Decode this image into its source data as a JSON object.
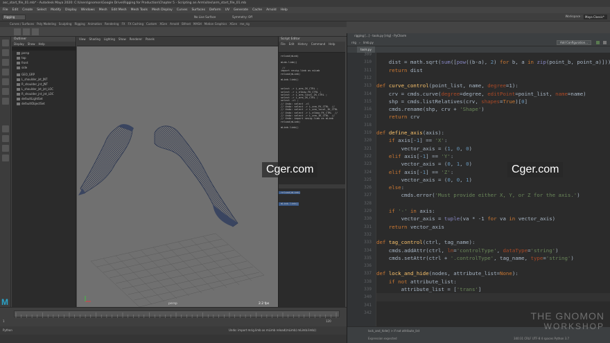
{
  "maya": {
    "window_title": "asc_start_file_01.mb* - Autodesk Maya 2020: C:\\Users\\gnomon\\Google Drive\\Rigging for Production\\Chapter 5 - Scripting an Arm\\sites\\arm_start_file_01.mb",
    "menus": [
      "File",
      "Edit",
      "Create",
      "Select",
      "Modify",
      "Display",
      "Windows",
      "Mesh",
      "Edit Mesh",
      "Mesh Tools",
      "Mesh Display",
      "Curves",
      "Surfaces",
      "Deform",
      "UV",
      "Generate",
      "Cache",
      "Arnold",
      "Help"
    ],
    "menu_set": "Rigging",
    "live_surface": "No Live Surface",
    "symmetry": "Symmetry: Off",
    "workspace": "Maya Classic*",
    "shelf_tabs": [
      "Curves / Surfaces",
      "Poly Modeling",
      "Sculpting",
      "Rigging",
      "Animation",
      "Rendering",
      "FX",
      "FX Caching",
      "Custom",
      "XGen",
      "Arnold",
      "Bifrost",
      "MASH",
      "Motion Graphics",
      "XGen",
      "me_rig"
    ],
    "outliner": {
      "title": "Outliner",
      "menus": [
        "Display",
        "Show",
        "Help"
      ],
      "items": [
        "persp",
        "top",
        "front",
        "side",
        "GEO_GRP",
        "L_shoulder_jnt_JNT",
        "R_shoulder_jnt_JNT",
        "L_shoulder_jnt_jnt_LOC",
        "R_shoulder_jnt_jnt_LOC",
        "defaultLightSet",
        "defaultObjectSet"
      ]
    },
    "viewport": {
      "menus": [
        "View",
        "Shading",
        "Lighting",
        "Show",
        "Renderer",
        "Panels"
      ],
      "camera": "persp",
      "fps": "2.2 fps"
    },
    "script_editor": {
      "title": "Script Editor",
      "menus": [
        "File",
        "Edit",
        "History",
        "Command",
        "Help"
      ],
      "history_lines": [
        "reload(mLmb)",
        "",
        "mLmb.limb()",
        "",
        " //",
        "import neuig.limb as mLimb",
        "reload(mLimb)",
        "",
        "mLimb.limb()",
        "",
        "",
        "select -r L_arm_IK_CTRL ;",
        "select -r L_elbow_FK_CTRL ;",
        "select -r L_arm_local_IK_CTRL ;",
        "select -r L_arm_IK_CTRL ;",
        "select -cl ;",
        "// Undo: select -cl",
        "// Undo: select -r L_arm_FK_CTRL  //",
        "// Undo: select -r L_arm_local_IK_CTRL",
        "// Undo: select -r L_elbow_FK_CTRL  //",
        "// Undo: select -r L_arm_IK_CTRL  //",
        "// Undo: import neuig.limb as mLimb",
        "reload(mLimb)",
        "",
        "mLimb.limb()"
      ],
      "input_lines": [
        "reload(mLimb)",
        "",
        "mLimb.limb()"
      ]
    },
    "timeline_start": "1",
    "timeline_end": "120",
    "command_lang": "Python",
    "command_feedback": "Undo: import mrig.limb as mLimb  reload(mLimb)  mLimb.limb()",
    "help_text": ""
  },
  "pycharm": {
    "title": "rigging [...] - tools.py [rrig] - PyCharm",
    "nav_project": "rrig",
    "nav_file": "limb.py",
    "config_button": "Add Configuration...",
    "tab": "tools.py",
    "lines": [
      {
        "n": "309",
        "code": ""
      },
      {
        "n": "310",
        "code": "    dist = math.sqrt(sum([pow((b-a), 2) for b, a in zip(point_b, point_a)]))"
      },
      {
        "n": "311",
        "code": "    return dist"
      },
      {
        "n": "312",
        "code": ""
      },
      {
        "n": "313",
        "code": "def curve_control(point_list, name, degree=1):"
      },
      {
        "n": "314",
        "code": "    crv = cmds.curve(degree=degree, editPoint=point_list, name=name)"
      },
      {
        "n": "315",
        "code": "    shp = cmds.listRelatives(crv, shapes=True)[0]"
      },
      {
        "n": "316",
        "code": "    cmds.rename(shp, crv + 'Shape')"
      },
      {
        "n": "317",
        "code": "    return crv"
      },
      {
        "n": "318",
        "code": ""
      },
      {
        "n": "319",
        "code": "def define_axis(axis):"
      },
      {
        "n": "320",
        "code": "    if axis[-1] == 'X':"
      },
      {
        "n": "321",
        "code": "        vector_axis = (1, 0, 0)"
      },
      {
        "n": "322",
        "code": "    elif axis[-1] == 'Y':"
      },
      {
        "n": "323",
        "code": "        vector_axis = (0, 1, 0)"
      },
      {
        "n": "324",
        "code": "    elif axis[-1] == 'Z':"
      },
      {
        "n": "325",
        "code": "        vector_axis = (0, 0, 1)"
      },
      {
        "n": "326",
        "code": "    else:"
      },
      {
        "n": "327",
        "code": "        cmds.error('Must provide either X, Y, or Z for the axis.')"
      },
      {
        "n": "328",
        "code": ""
      },
      {
        "n": "329",
        "code": "    if '-' in axis:"
      },
      {
        "n": "330",
        "code": "        vector_axis = tuple(va * -1 for va in vector_axis)"
      },
      {
        "n": "331",
        "code": "    return vector_axis"
      },
      {
        "n": "332",
        "code": ""
      },
      {
        "n": "333",
        "code": "def tag_control(ctrl, tag_name):"
      },
      {
        "n": "334",
        "code": "    cmds.addAttr(ctrl, ln='controlType', dataType='string')"
      },
      {
        "n": "335",
        "code": "    cmds.setAttr(ctrl + '.controlType', tag_name, type='string')"
      },
      {
        "n": "336",
        "code": ""
      },
      {
        "n": "337",
        "code": "def lock_and_hide(nodes, attribute_list=None):"
      },
      {
        "n": "338",
        "code": "    if not attribute_list:"
      },
      {
        "n": "339",
        "code": "        attribute_list = ['trans']"
      },
      {
        "n": "340",
        "code": ""
      },
      {
        "n": "341",
        "code": ""
      },
      {
        "n": "342",
        "code": ""
      }
    ],
    "breadcrumb": "lock_and_hide()  >  if not attribute_list",
    "status_left": "Expression expected",
    "status_right": "340:31  CRLF  UTF-8  4 spaces  Python 3.7"
  },
  "watermark": "Cger.com",
  "gnomon": {
    "line1": "THE GNOMON",
    "line2": "WORKSHOP"
  }
}
